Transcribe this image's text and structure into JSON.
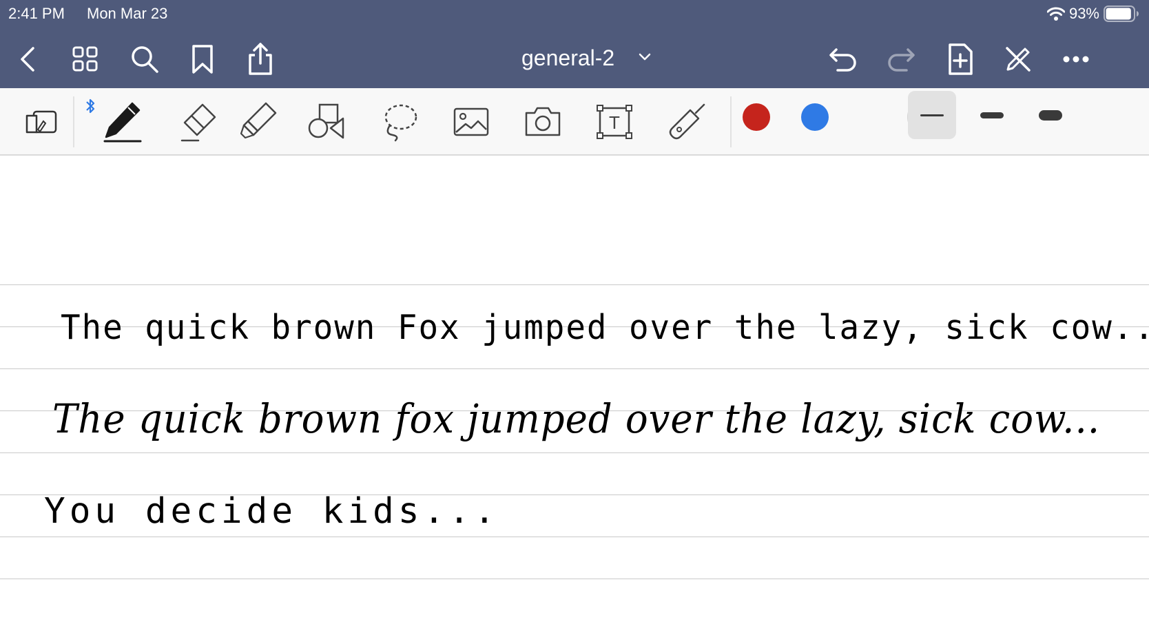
{
  "status_bar": {
    "time": "2:41 PM",
    "date": "Mon Mar 23",
    "battery_percent": "93%",
    "battery_level": 0.93,
    "wifi_icon": "wifi-icon",
    "battery_icon": "battery-icon"
  },
  "nav": {
    "left_icons": [
      "back-chevron-icon",
      "grid-icon",
      "search-icon",
      "bookmark-icon",
      "share-icon"
    ],
    "document_title": "general-2",
    "title_menu_icon": "chevron-down-icon",
    "right_icons": [
      "undo-icon",
      "redo-icon",
      "add-page-icon",
      "pen-off-icon",
      "more-icon"
    ],
    "redo_enabled": false
  },
  "toolbar": {
    "tools": [
      "read-only-mode-icon",
      "pen-icon",
      "eraser-icon",
      "highlighter-icon",
      "shapes-icon",
      "lasso-icon",
      "image-icon",
      "camera-icon",
      "text-icon",
      "laser-pointer-icon"
    ],
    "active_tool": "pen-icon",
    "text_tool_glyph": "T",
    "stylus_connected_icon": "bluetooth-icon",
    "colors": [
      "#c5241c",
      "#2f7ae5",
      "#000000"
    ],
    "selected_color": "#000000",
    "thickness_presets": [
      "thin",
      "medium",
      "thick"
    ],
    "selected_thickness": "thin"
  },
  "canvas": {
    "handwriting_lines": [
      "The quick brown Fox jumped over the lazy, sick cow...",
      "The quick brown fox jumped over the lazy, sick cow...",
      "You decide kids..."
    ],
    "ruled_paper": true,
    "ink_color": "#000000"
  }
}
